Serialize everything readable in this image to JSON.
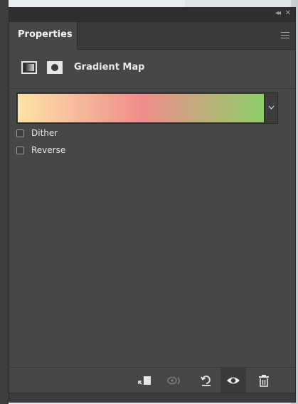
{
  "panel": {
    "tab_label": "Properties",
    "icons": {
      "collapse": "double-chevron-left-icon",
      "close": "close-icon",
      "menu": "hamburger-menu-icon"
    }
  },
  "header": {
    "title": "Gradient Map",
    "icons": [
      "gradient-map-adjustment-icon",
      "layer-mask-icon"
    ]
  },
  "gradient": {
    "stops": [
      "#fde3a7",
      "#f08d8c",
      "#8fd068"
    ],
    "dropdown_icon": "chevron-down-icon"
  },
  "options": {
    "dither_label": "Dither",
    "dither_checked": false,
    "reverse_label": "Reverse",
    "reverse_checked": false
  },
  "footer": {
    "buttons": [
      "clip-to-layer-icon",
      "view-previous-state-icon",
      "reset-icon",
      "visibility-eye-icon",
      "trash-icon"
    ]
  }
}
